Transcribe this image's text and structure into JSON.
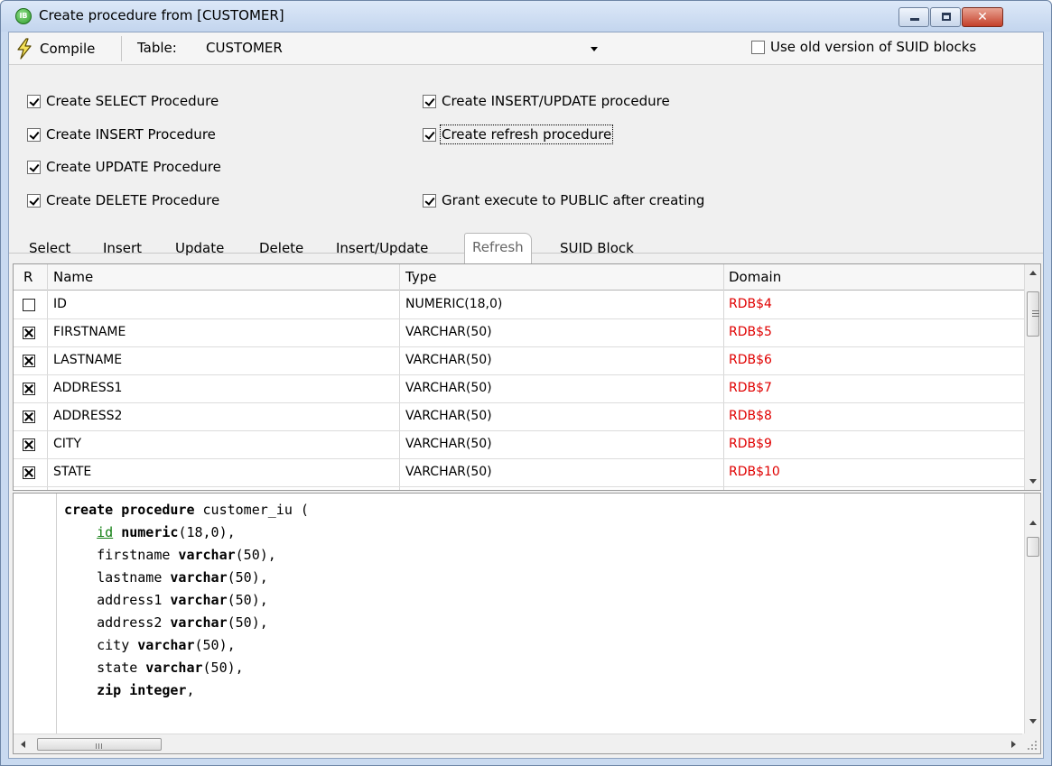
{
  "window": {
    "title": "Create procedure from [CUSTOMER]",
    "app_icon_text": "IB"
  },
  "toolbar": {
    "compile_label": "Compile",
    "table_label": "Table:",
    "table_value": "CUSTOMER",
    "old_suid_label": "Use old version of SUID blocks",
    "old_suid_checked": false
  },
  "options": {
    "select_proc": "Create SELECT Procedure",
    "insert_proc": "Create INSERT Procedure",
    "update_proc": "Create UPDATE Procedure",
    "delete_proc": "Create DELETE Procedure",
    "insert_update_proc": "Create INSERT/UPDATE procedure",
    "refresh_proc": "Create refresh procedure",
    "grant_execute": "Grant execute to PUBLIC after creating"
  },
  "tabs": [
    "Select",
    "Insert",
    "Update",
    "Delete",
    "Insert/Update",
    "Refresh",
    "SUID Block"
  ],
  "active_tab": "Refresh",
  "grid": {
    "headers": {
      "r": "R",
      "name": "Name",
      "type": "Type",
      "domain": "Domain"
    },
    "rows": [
      {
        "checked": false,
        "name": "ID",
        "type": "NUMERIC(18,0)",
        "domain": "RDB$4"
      },
      {
        "checked": true,
        "name": "FIRSTNAME",
        "type": "VARCHAR(50)",
        "domain": "RDB$5"
      },
      {
        "checked": true,
        "name": "LASTNAME",
        "type": "VARCHAR(50)",
        "domain": "RDB$6"
      },
      {
        "checked": true,
        "name": "ADDRESS1",
        "type": "VARCHAR(50)",
        "domain": "RDB$7"
      },
      {
        "checked": true,
        "name": "ADDRESS2",
        "type": "VARCHAR(50)",
        "domain": "RDB$8"
      },
      {
        "checked": true,
        "name": "CITY",
        "type": "VARCHAR(50)",
        "domain": "RDB$9"
      },
      {
        "checked": true,
        "name": "STATE",
        "type": "VARCHAR(50)",
        "domain": "RDB$10"
      }
    ]
  },
  "editor": {
    "lines": {
      "l1_kw": "create procedure",
      "l1_rest": " customer_iu (",
      "l2_param": "id",
      "l2_type": " numeric",
      "l2_rest": "(18,0),",
      "l3_name": "firstname",
      "l3_type": " varchar",
      "l3_rest": "(50),",
      "l4_name": "lastname",
      "l4_type": " varchar",
      "l4_rest": "(50),",
      "l5_name": "address1",
      "l5_type": " varchar",
      "l5_rest": "(50),",
      "l6_name": "address2",
      "l6_type": " varchar",
      "l6_rest": "(50),",
      "l7_name": "city",
      "l7_type": " varchar",
      "l7_rest": "(50),",
      "l8_name": "state",
      "l8_type": " varchar",
      "l8_rest": "(50),",
      "l9_name": "zip",
      "l9_type": " integer",
      "l9_rest": ","
    },
    "hscroll_grip": "III"
  },
  "colors": {
    "domain_text": "#e00000",
    "highlight_param": "#148014"
  }
}
